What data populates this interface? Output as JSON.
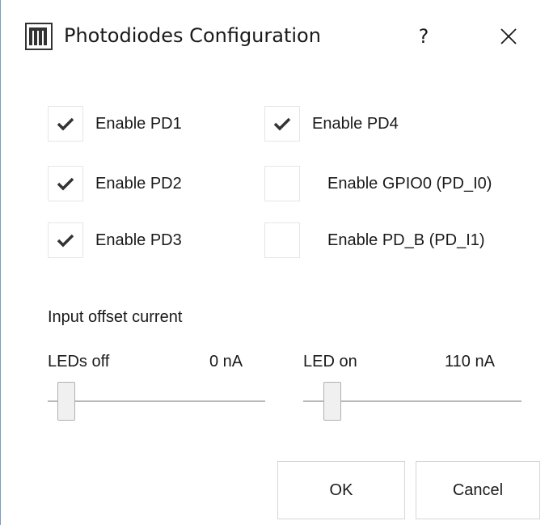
{
  "window": {
    "title": "Photodiodes Configuration",
    "help_label": "?",
    "app_icon": "lattice-app-icon",
    "close_icon": "close-icon"
  },
  "checkboxes": [
    {
      "label": "Enable PD1",
      "checked": true
    },
    {
      "label": "Enable PD2",
      "checked": true
    },
    {
      "label": "Enable PD3",
      "checked": true
    },
    {
      "label": "Enable PD4",
      "checked": true
    },
    {
      "label": "Enable GPIO0 (PD_I0)",
      "checked": false
    },
    {
      "label": "Enable PD_B (PD_I1)",
      "checked": false
    }
  ],
  "offset": {
    "section_label": "Input offset current",
    "leds_off": {
      "label": "LEDs off",
      "value": "0 nA",
      "slider_fraction": 0.05
    },
    "led_on": {
      "label": "LED on",
      "value": "110 nA",
      "slider_fraction": 0.1
    }
  },
  "buttons": {
    "ok": "OK",
    "cancel": "Cancel"
  },
  "colors": {
    "window_border": "#7a9cc6",
    "check_mark": "#333333"
  }
}
